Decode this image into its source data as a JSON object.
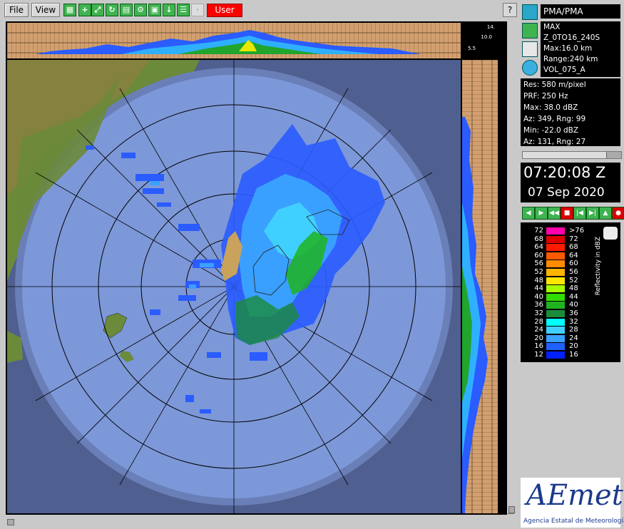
{
  "toolbar": {
    "file_label": "File",
    "view_label": "View",
    "user_label": "User",
    "help_label": "?",
    "icons": [
      "layers-icon",
      "crosshair-icon",
      "zoom-icon",
      "refresh-icon",
      "print-icon",
      "settings-icon",
      "export-icon",
      "table-icon",
      "disabled-icon"
    ]
  },
  "product": {
    "site": "PMA/PMA",
    "type": "MAX",
    "name": "Z_0TO16_240S",
    "max_height": "Max:16.0 km",
    "range": "Range:240 km",
    "volume": "VOL_075_A"
  },
  "profile_scale": {
    "top": "14.",
    "mid": "10.0",
    "low": "5.5"
  },
  "info": {
    "res": "Res: 580 m/pixel",
    "prf": "PRF: 250 Hz",
    "max": "Max: 38.0 dBZ",
    "max_pos": "Az:  349, Rng: 99",
    "min": "Min: -22.0 dBZ",
    "min_pos": "Az:  131, Rng: 27"
  },
  "time": "07:20:08 Z",
  "date": "07 Sep 2020",
  "legend": {
    "title": "Reflectivity in dBZ",
    "rows": [
      {
        "lo": "72",
        "hi": ">76",
        "color": "#ff00aa"
      },
      {
        "lo": "68",
        "hi": "72",
        "color": "#e00000"
      },
      {
        "lo": "64",
        "hi": "68",
        "color": "#ff1a00"
      },
      {
        "lo": "60",
        "hi": "64",
        "color": "#ff5a00"
      },
      {
        "lo": "56",
        "hi": "60",
        "color": "#ff8c00"
      },
      {
        "lo": "52",
        "hi": "56",
        "color": "#ffb400"
      },
      {
        "lo": "48",
        "hi": "52",
        "color": "#ffe600"
      },
      {
        "lo": "44",
        "hi": "48",
        "color": "#a6ff00"
      },
      {
        "lo": "40",
        "hi": "44",
        "color": "#32dc00"
      },
      {
        "lo": "36",
        "hi": "40",
        "color": "#1fb41f"
      },
      {
        "lo": "32",
        "hi": "36",
        "color": "#1a8c3c"
      },
      {
        "lo": "28",
        "hi": "32",
        "color": "#00ffff"
      },
      {
        "lo": "24",
        "hi": "28",
        "color": "#40d0ff"
      },
      {
        "lo": "20",
        "hi": "24",
        "color": "#3aa0ff"
      },
      {
        "lo": "16",
        "hi": "20",
        "color": "#2060ff"
      },
      {
        "lo": "12",
        "hi": "16",
        "color": "#0020ff"
      }
    ]
  },
  "logo": {
    "brand": "AEmet",
    "subtitle": "Agencia Estatal de Meteorología"
  },
  "colors": {
    "background_range": "#7d98d8",
    "outer": "#6a7fb8",
    "sea_outside": "#4f5f8f",
    "land": "#6b8a3a",
    "toolbar": "#c9c9c9"
  }
}
